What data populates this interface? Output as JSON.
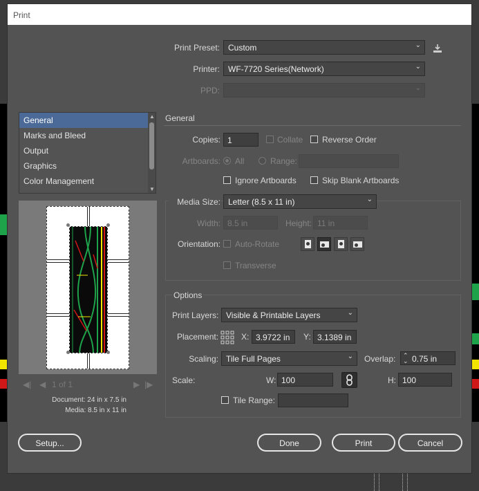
{
  "window": {
    "title": "Print"
  },
  "top": {
    "preset_label": "Print Preset:",
    "preset_value": "Custom",
    "printer_label": "Printer:",
    "printer_value": "WF-7720 Series(Network)",
    "ppd_label": "PPD:",
    "ppd_value": ""
  },
  "sidebar": {
    "items": [
      {
        "label": "General",
        "selected": true
      },
      {
        "label": "Marks and Bleed"
      },
      {
        "label": "Output"
      },
      {
        "label": "Graphics"
      },
      {
        "label": "Color Management"
      }
    ]
  },
  "preview": {
    "pager_text": "1 of 1",
    "document_info": "Document: 24 in x 7.5 in",
    "media_info": "Media: 8.5 in x 11 in"
  },
  "general": {
    "header": "General",
    "copies_label": "Copies:",
    "copies_value": "1",
    "collate_label": "Collate",
    "reverse_order_label": "Reverse Order",
    "artboards_label": "Artboards:",
    "all_label": "All",
    "range_label": "Range:",
    "range_value": "",
    "ignore_artboards_label": "Ignore Artboards",
    "skip_blank_label": "Skip Blank Artboards",
    "media_size_label": "Media Size:",
    "media_size_value": "Letter (8.5 x 11 in)",
    "width_label": "Width:",
    "width_value": "8.5 in",
    "height_label": "Height:",
    "height_value": "11 in",
    "orientation_label": "Orientation:",
    "auto_rotate_label": "Auto-Rotate",
    "transverse_label": "Transverse"
  },
  "options": {
    "header": "Options",
    "print_layers_label": "Print Layers:",
    "print_layers_value": "Visible & Printable Layers",
    "placement_label": "Placement:",
    "x_label": "X:",
    "x_value": "3.9722 in",
    "y_label": "Y:",
    "y_value": "3.1389 in",
    "scaling_label": "Scaling:",
    "scaling_value": "Tile Full Pages",
    "overlap_label": "Overlap:",
    "overlap_value": "0.75 in",
    "scale_label": "Scale:",
    "w_label": "W:",
    "w_value": "100",
    "h_label": "H:",
    "h_value": "100",
    "tile_range_label": "Tile Range:",
    "tile_range_value": ""
  },
  "buttons": {
    "setup": "Setup...",
    "done": "Done",
    "print": "Print",
    "cancel": "Cancel"
  },
  "colors": {
    "dialog_bg": "#535353",
    "selected_item": "#4c6a98",
    "track_green": "#1ea24a",
    "track_yellow": "#f2e600",
    "track_red": "#d01818"
  }
}
